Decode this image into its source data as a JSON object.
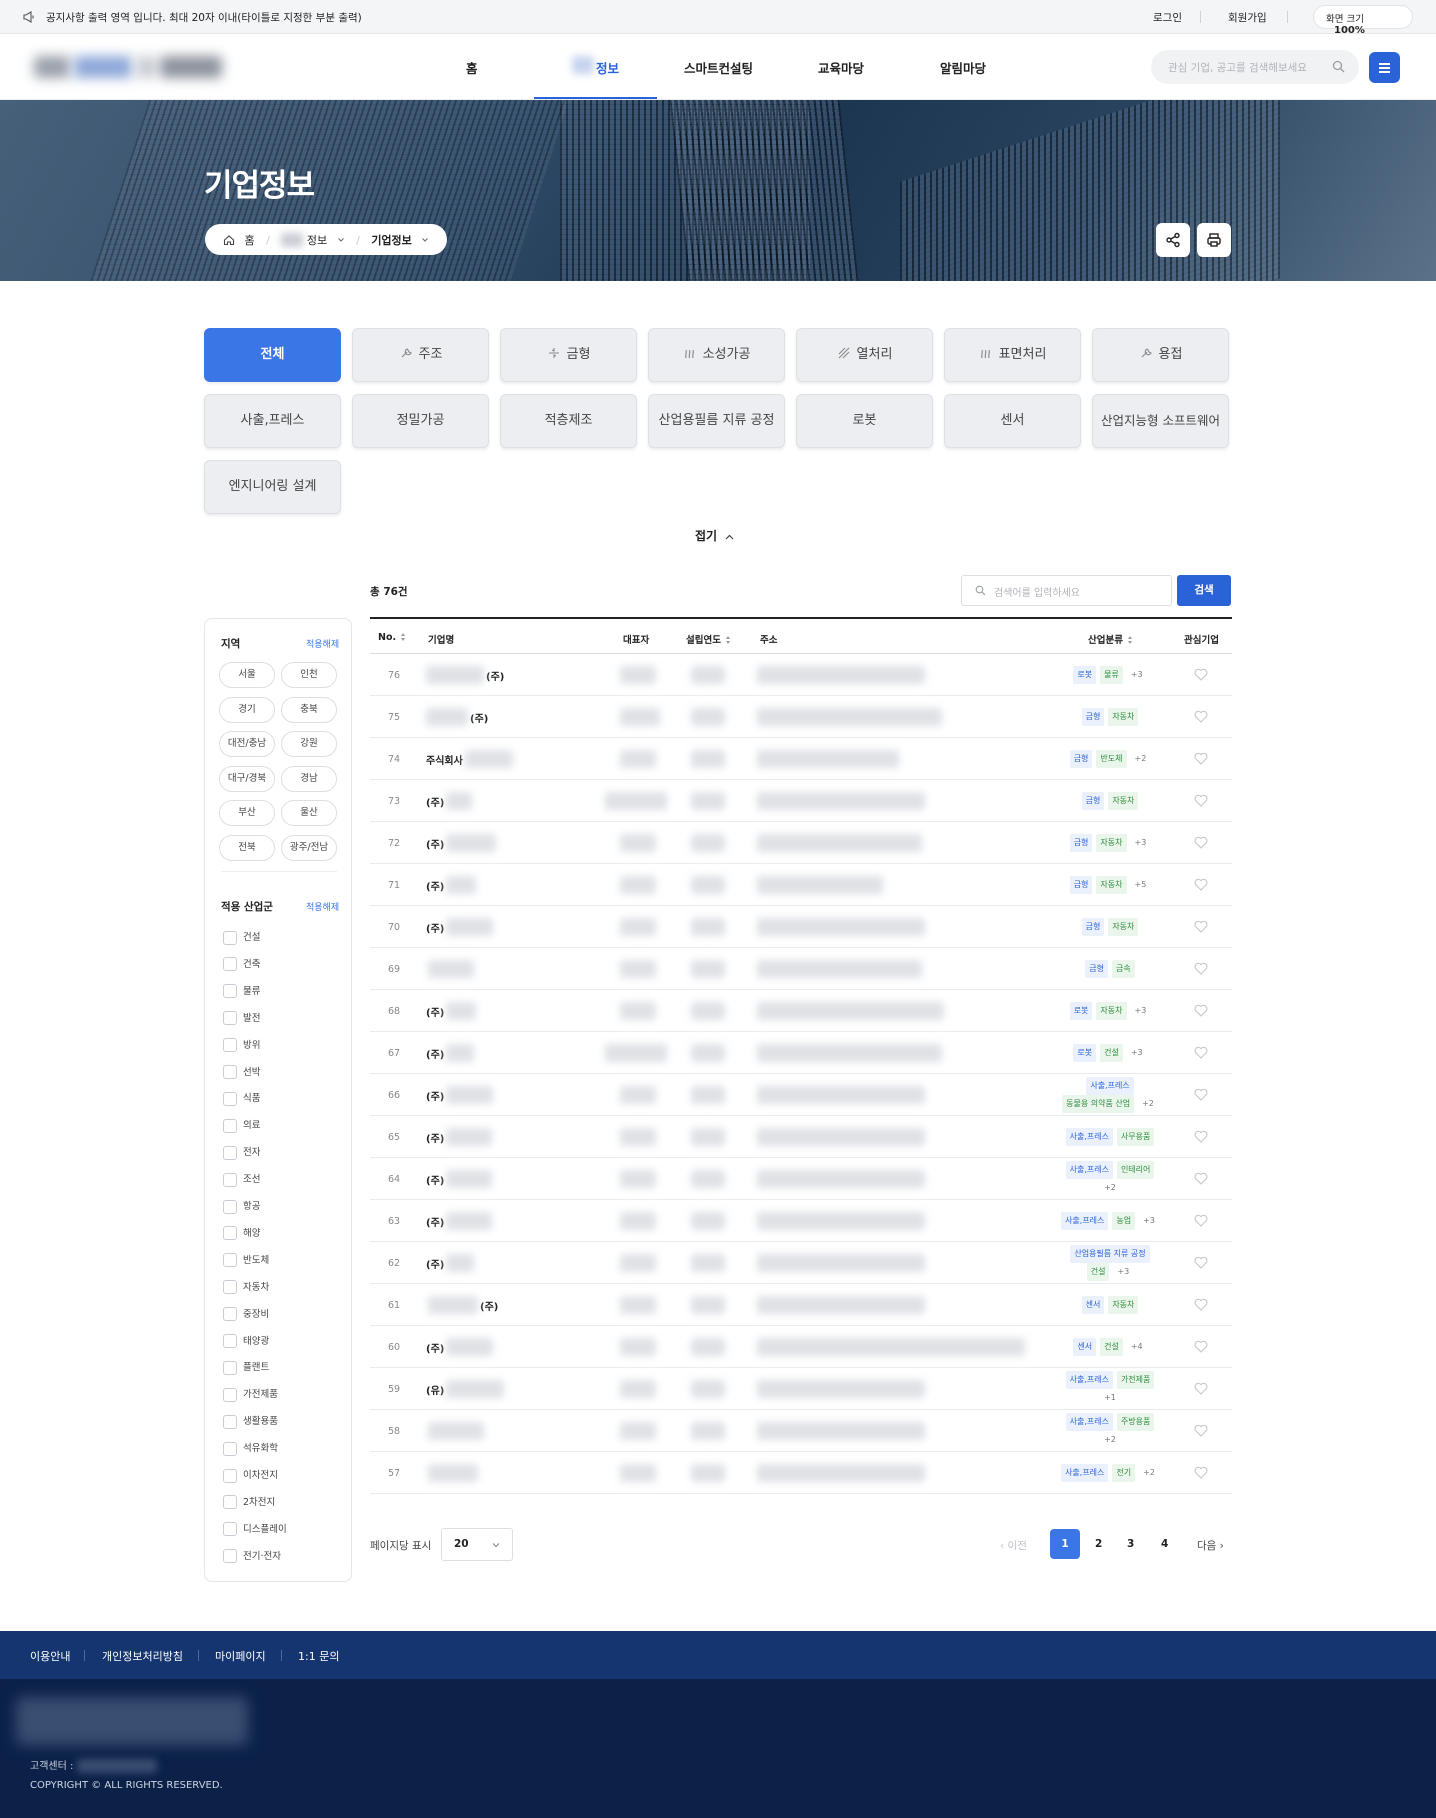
{
  "notice": {
    "text": "공지사항 출력 영역 입니다. 최대 20자 이내(타이틀로 지정한 부분 출력)"
  },
  "util": {
    "login": "로그인",
    "signup": "회원가입",
    "zoom_label": "화면 크기",
    "zoom_value": "100%"
  },
  "nav": {
    "items": [
      "홈",
      "정보",
      "스마트컨설팅",
      "교육마당",
      "알림마당"
    ],
    "active_index": 1,
    "search_placeholder": "관심 기업, 공고를 검색해보세요"
  },
  "banner": {
    "title": "기업정보",
    "breadcrumb": {
      "home": "홈",
      "level1": "정보",
      "level2": "기업정보"
    }
  },
  "categories": {
    "items": [
      "전체",
      "주조",
      "금형",
      "소성가공",
      "열처리",
      "표면처리",
      "용접",
      "사출,프레스",
      "정밀가공",
      "적층제조",
      "산업용필름 지류 공정",
      "로봇",
      "센서",
      "산업지능형 소프트웨어",
      "엔지니어링 설계"
    ],
    "active_index": 0,
    "fold_label": "접기"
  },
  "sidebar": {
    "region_title": "지역",
    "region_reset": "적용해제",
    "regions": [
      "서울",
      "인천",
      "경기",
      "충북",
      "대전/충남",
      "강원",
      "대구/경북",
      "경남",
      "부산",
      "울산",
      "전북",
      "광주/전남"
    ],
    "industry_title": "적용 산업군",
    "industry_reset": "적용해제",
    "industries": [
      "건설",
      "건축",
      "물류",
      "발전",
      "방위",
      "선박",
      "식품",
      "의료",
      "전자",
      "조선",
      "항공",
      "해양",
      "반도체",
      "자동차",
      "중장비",
      "태양광",
      "플랜트",
      "가전제품",
      "생활용품",
      "석유화학",
      "이차전지",
      "2차전지",
      "디스플레이",
      "전기·전자"
    ]
  },
  "results": {
    "total": "총 76건",
    "search_placeholder": "검색어를 입력하세요",
    "search_button": "검색",
    "columns": {
      "no": "No.",
      "name": "기업명",
      "rep": "대표자",
      "year": "설립연도",
      "addr": "주소",
      "industry": "산업분류",
      "fav": "관심기업"
    },
    "rows": [
      {
        "no": "76",
        "prefix": "",
        "suffix": "(주)",
        "tags": [
          [
            "로봇",
            "b"
          ],
          [
            "물류",
            "g"
          ],
          [
            "+3",
            "m"
          ]
        ]
      },
      {
        "no": "75",
        "prefix": "",
        "suffix": "(주)",
        "tags": [
          [
            "금형",
            "b"
          ],
          [
            "자동차",
            "g"
          ]
        ]
      },
      {
        "no": "74",
        "prefix": "주식회사",
        "suffix": "",
        "tags": [
          [
            "금형",
            "b"
          ],
          [
            "반도체",
            "g"
          ],
          [
            "+2",
            "m"
          ]
        ]
      },
      {
        "no": "73",
        "prefix": "(주)",
        "suffix": "",
        "tags": [
          [
            "금형",
            "b"
          ],
          [
            "자동차",
            "g"
          ]
        ]
      },
      {
        "no": "72",
        "prefix": "(주)",
        "suffix": "",
        "tags": [
          [
            "금형",
            "b"
          ],
          [
            "자동차",
            "g"
          ],
          [
            "+3",
            "m"
          ]
        ]
      },
      {
        "no": "71",
        "prefix": "(주)",
        "suffix": "",
        "tags": [
          [
            "금형",
            "b"
          ],
          [
            "자동차",
            "g"
          ],
          [
            "+5",
            "m"
          ]
        ]
      },
      {
        "no": "70",
        "prefix": "(주)",
        "suffix": "",
        "tags": [
          [
            "금형",
            "b"
          ],
          [
            "자동차",
            "g"
          ]
        ]
      },
      {
        "no": "69",
        "prefix": "",
        "suffix": "",
        "tags": [
          [
            "금형",
            "b"
          ],
          [
            "금속",
            "g"
          ]
        ]
      },
      {
        "no": "68",
        "prefix": "(주)",
        "suffix": "",
        "tags": [
          [
            "로봇",
            "b"
          ],
          [
            "자동차",
            "g"
          ],
          [
            "+3",
            "m"
          ]
        ]
      },
      {
        "no": "67",
        "prefix": "(주)",
        "suffix": "",
        "tags": [
          [
            "로봇",
            "b"
          ],
          [
            "건설",
            "g"
          ],
          [
            "+3",
            "m"
          ]
        ]
      },
      {
        "no": "66",
        "prefix": "(주)",
        "suffix": "",
        "tags": [
          [
            "사출,프레스",
            "b"
          ]
        ],
        "tags2": [
          [
            "동물용 의약품 산업",
            "g"
          ],
          [
            "+2",
            "m"
          ]
        ]
      },
      {
        "no": "65",
        "prefix": "(주)",
        "suffix": "",
        "tags": [
          [
            "사출,프레스",
            "b"
          ],
          [
            "사무용품",
            "g"
          ]
        ]
      },
      {
        "no": "64",
        "prefix": "(주)",
        "suffix": "",
        "tags": [
          [
            "사출,프레스",
            "b"
          ],
          [
            "인테리어",
            "g"
          ]
        ],
        "tags2": [
          [
            "+2",
            "m"
          ]
        ]
      },
      {
        "no": "63",
        "prefix": "(주)",
        "suffix": "",
        "tags": [
          [
            "사출,프레스",
            "b"
          ],
          [
            "농업",
            "g"
          ],
          [
            "+3",
            "m"
          ]
        ]
      },
      {
        "no": "62",
        "prefix": "(주)",
        "suffix": "",
        "tags": [
          [
            "산업용필름 지류 공정",
            "b"
          ]
        ],
        "tags2": [
          [
            "건설",
            "g"
          ],
          [
            "+3",
            "m"
          ]
        ]
      },
      {
        "no": "61",
        "prefix": "",
        "suffix": "(주)",
        "tags": [
          [
            "센서",
            "b"
          ],
          [
            "자동차",
            "g"
          ]
        ]
      },
      {
        "no": "60",
        "prefix": "(주)",
        "suffix": "",
        "tags": [
          [
            "센서",
            "b"
          ],
          [
            "건설",
            "g"
          ],
          [
            "+4",
            "m"
          ]
        ]
      },
      {
        "no": "59",
        "prefix": "(유)",
        "suffix": "",
        "tags": [
          [
            "사출,프레스",
            "b"
          ],
          [
            "가전제품",
            "g"
          ]
        ],
        "tags2": [
          [
            "+1",
            "m"
          ]
        ]
      },
      {
        "no": "58",
        "prefix": "",
        "suffix": "",
        "tags": [
          [
            "사출,프레스",
            "b"
          ],
          [
            "주방용품",
            "g"
          ]
        ],
        "tags2": [
          [
            "+2",
            "m"
          ]
        ]
      },
      {
        "no": "57",
        "prefix": "",
        "suffix": "",
        "tags": [
          [
            "사출,프레스",
            "b"
          ],
          [
            "전기",
            "g"
          ],
          [
            "+2",
            "m"
          ]
        ]
      }
    ]
  },
  "pager": {
    "per_page_label": "페이지당 표시",
    "per_page_value": "20",
    "prev": "이전",
    "next": "다음",
    "pages": [
      "1",
      "2",
      "3",
      "4"
    ],
    "active": "1"
  },
  "footer": {
    "links": [
      "이용안내",
      "개인정보처리방침",
      "마이페이지",
      "1:1 문의"
    ],
    "cs_label": "고객센터 :",
    "copyright": "COPYRIGHT © ALL RIGHTS RESERVED."
  },
  "icons": {
    "notice": "megaphone-icon",
    "search": "search-icon",
    "menu": "hamburger-menu-icon",
    "home": "home-icon",
    "share": "share-icon",
    "print": "print-icon",
    "heart": "heart-icon"
  },
  "colors": {
    "primary": "#2a62d8",
    "footer_nav": "#14356f",
    "footer_body": "#0b2148"
  }
}
